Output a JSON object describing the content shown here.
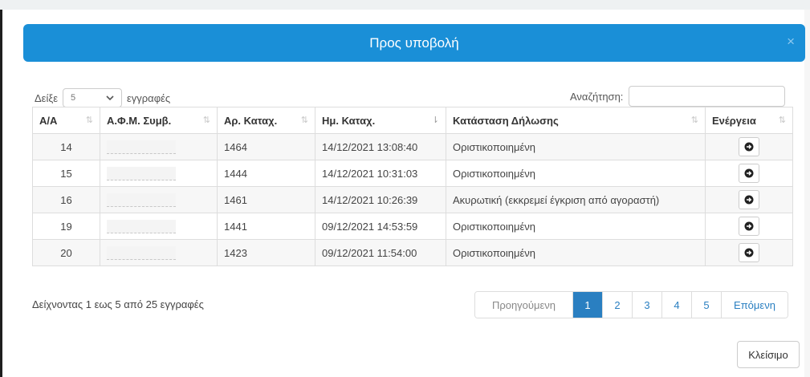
{
  "modal": {
    "title": "Προς υποβολή",
    "close_icon": "×",
    "close_button_label": "Κλείσιμο"
  },
  "length_control": {
    "prefix": "Δείξε",
    "value": "5",
    "suffix": "εγγραφές"
  },
  "search": {
    "label": "Αναζήτηση:",
    "value": ""
  },
  "table": {
    "columns": [
      "Α/Α",
      "Α.Φ.Μ. Συμβ.",
      "Αρ. Καταχ.",
      "Ημ. Καταχ.",
      "Κατάσταση Δήλωσης",
      "Ενέργεια"
    ],
    "rows": [
      {
        "aa": "14",
        "afm": "",
        "ar": "1464",
        "date": "14/12/2021 13:08:40",
        "status": "Οριστικοποιημένη"
      },
      {
        "aa": "15",
        "afm": "",
        "ar": "1444",
        "date": "14/12/2021 10:31:03",
        "status": "Οριστικοποιημένη"
      },
      {
        "aa": "16",
        "afm": "",
        "ar": "1461",
        "date": "14/12/2021 10:26:39",
        "status": "Ακυρωτική (εκκρεμεί έγκριση από αγοραστή)"
      },
      {
        "aa": "19",
        "afm": "",
        "ar": "1441",
        "date": "09/12/2021 14:53:59",
        "status": "Οριστικοποιημένη"
      },
      {
        "aa": "20",
        "afm": "",
        "ar": "1423",
        "date": "09/12/2021 11:54:00",
        "status": "Οριστικοποιημένη"
      }
    ],
    "action_icon": "arrow-circle-right-icon"
  },
  "info_text": "Δείχνοντας 1 εως 5 από 25 εγγραφές",
  "pagination": {
    "prev_label": "Προηγούμενη",
    "pages": [
      "1",
      "2",
      "3",
      "4",
      "5"
    ],
    "active_page": "1",
    "next_label": "Επόμενη"
  },
  "colors": {
    "header_bg": "#1a8fd7",
    "active_page_bg": "#2a7fc1",
    "link": "#2a7fc1"
  }
}
